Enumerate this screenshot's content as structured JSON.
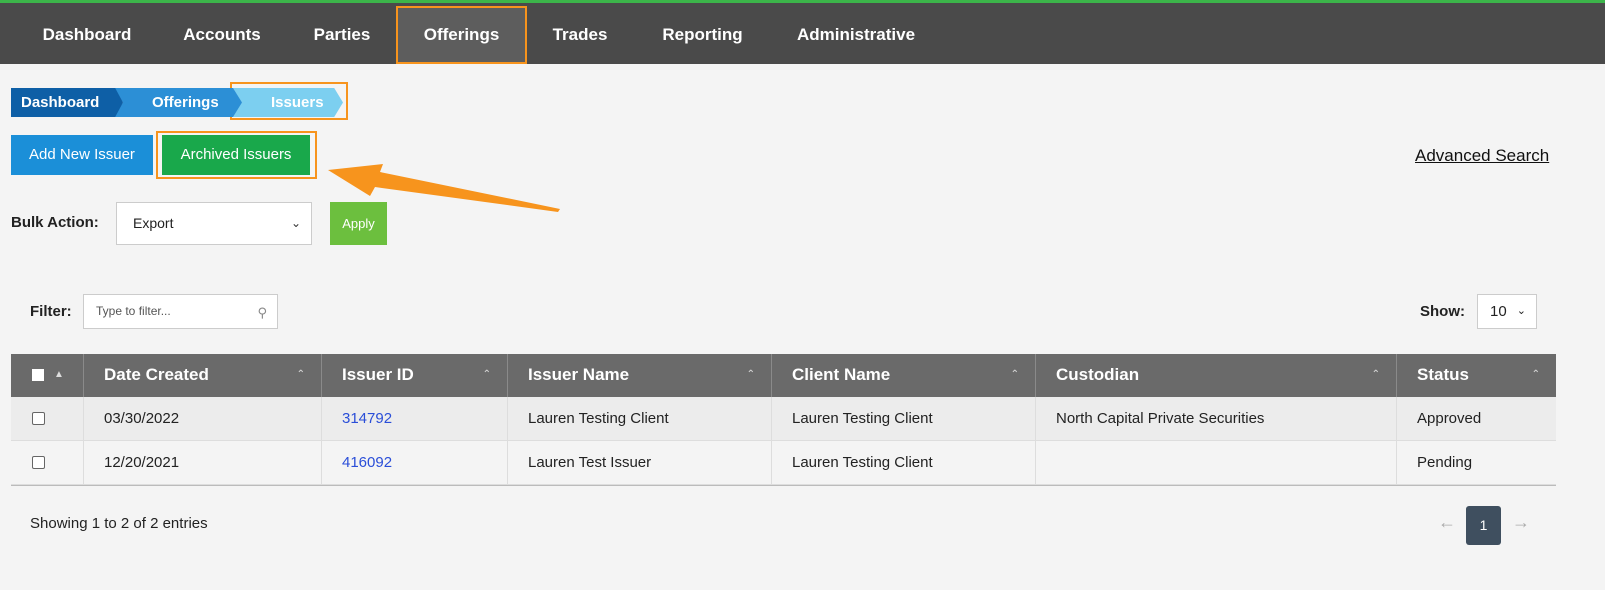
{
  "nav": {
    "items": [
      "Dashboard",
      "Accounts",
      "Parties",
      "Offerings",
      "Trades",
      "Reporting",
      "Administrative"
    ],
    "active": "Offerings"
  },
  "breadcrumb": [
    "Dashboard",
    "Offerings",
    "Issuers"
  ],
  "actions": {
    "add_label": "Add New Issuer",
    "archived_label": "Archived Issuers",
    "advanced_search": "Advanced Search"
  },
  "bulk": {
    "label": "Bulk Action:",
    "selected": "Export",
    "apply": "Apply"
  },
  "filter": {
    "label": "Filter:",
    "placeholder": "Type to filter...",
    "show_label": "Show:",
    "show_value": "10"
  },
  "table": {
    "columns": [
      "Date Created",
      "Issuer ID",
      "Issuer Name",
      "Client Name",
      "Custodian",
      "Status"
    ],
    "rows": [
      {
        "date": "03/30/2022",
        "id": "314792",
        "issuer": "Lauren Testing Client",
        "client": "Lauren Testing Client",
        "custodian": "North Capital Private Securities",
        "status": "Approved"
      },
      {
        "date": "12/20/2021",
        "id": "416092",
        "issuer": "Lauren Test Issuer",
        "client": "Lauren Testing Client",
        "custodian": "",
        "status": "Pending"
      }
    ]
  },
  "footer": {
    "showing": "Showing 1 to 2 of 2 entries",
    "page": "1",
    "prev": "←",
    "next": "→"
  },
  "colors": {
    "highlight": "#f7941d",
    "nav_bg": "#4a4a4a",
    "add_button": "#1b8fd8",
    "archived_button": "#19a84b",
    "apply_button": "#6cbf3e",
    "link": "#2a4ed8"
  }
}
